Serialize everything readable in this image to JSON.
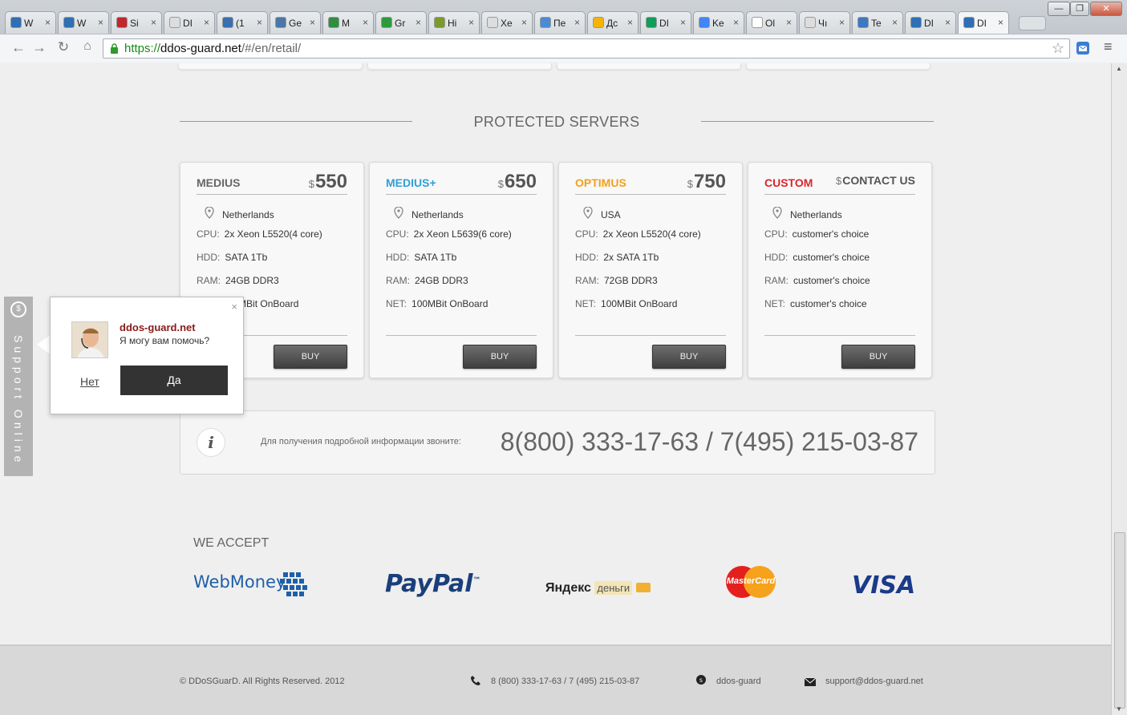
{
  "browser": {
    "tabs": [
      {
        "label": "W",
        "color": "#2f6fb4"
      },
      {
        "label": "W",
        "color": "#2f6fb4"
      },
      {
        "label": "Si",
        "color": "#c0282d"
      },
      {
        "label": "DI",
        "color": "#dddddd"
      },
      {
        "label": "(1",
        "color": "#3a6fb0"
      },
      {
        "label": "Ge",
        "color": "#4a76a8"
      },
      {
        "label": "M",
        "color": "#2f8f3f"
      },
      {
        "label": "Gr",
        "color": "#2e9b3a"
      },
      {
        "label": "Hi",
        "color": "#7a9a2a"
      },
      {
        "label": "Xe",
        "color": "#dddddd"
      },
      {
        "label": "Пе",
        "color": "#4a8bd6"
      },
      {
        "label": "Дс",
        "color": "#f4b400"
      },
      {
        "label": "DI",
        "color": "#0f9d58"
      },
      {
        "label": "Ke",
        "color": "#4285f4"
      },
      {
        "label": "Ol",
        "color": "#ffffff"
      },
      {
        "label": "Чı",
        "color": "#dddddd"
      },
      {
        "label": "Te",
        "color": "#3c78c3"
      },
      {
        "label": "DI",
        "color": "#2f6fb4"
      },
      {
        "label": "DI",
        "color": "#2f6fb4"
      }
    ],
    "url_scheme": "https://",
    "url_host": "ddos-guard.net",
    "url_path": "/#/en/retail/",
    "tab_close": "×",
    "win_min": "—",
    "win_max": "❐",
    "win_close": "✕"
  },
  "section": {
    "title": "PROTECTED SERVERS"
  },
  "servers": [
    {
      "name": "MEDIUS",
      "name_color": "#666666",
      "currency": "$",
      "price": "550",
      "location": "Netherlands",
      "cpu_label": "CPU:",
      "cpu": "2x Xeon L5520(4 core)",
      "hdd_label": "HDD:",
      "hdd": "SATA 1Tb",
      "ram_label": "RAM:",
      "ram": "24GB DDR3",
      "net_label": "NET:",
      "net": "100MBit OnBoard",
      "buy": "BUY"
    },
    {
      "name": "MEDIUS+",
      "name_color": "#2f9fd8",
      "currency": "$",
      "price": "650",
      "location": "Netherlands",
      "cpu_label": "CPU:",
      "cpu": "2x Xeon L5639(6 core)",
      "hdd_label": "HDD:",
      "hdd": "SATA 1Tb",
      "ram_label": "RAM:",
      "ram": "24GB DDR3",
      "net_label": "NET:",
      "net": "100MBit OnBoard",
      "buy": "BUY"
    },
    {
      "name": "OPTIMUS",
      "name_color": "#f0a020",
      "currency": "$",
      "price": "750",
      "location": "USA",
      "cpu_label": "CPU:",
      "cpu": "2x Xeon L5520(4 core)",
      "hdd_label": "HDD:",
      "hdd": "2x SATA 1Tb",
      "ram_label": "RAM:",
      "ram": "72GB DDR3",
      "net_label": "NET:",
      "net": "100MBit OnBoard",
      "buy": "BUY"
    },
    {
      "name": "CUSTOM",
      "name_color": "#d9262c",
      "currency": "$",
      "price": "CONTACT US",
      "location": "Netherlands",
      "cpu_label": "CPU:",
      "cpu": "customer's choice",
      "hdd_label": "HDD:",
      "hdd": "customer's choice",
      "ram_label": "RAM:",
      "ram": "customer's choice",
      "net_label": "NET:",
      "net": "customer's choice",
      "buy": "BUY"
    }
  ],
  "info": {
    "icon": "i",
    "text": "Для получения подробной информации звоните:",
    "phone": "8(800) 333-17-63 / 7(495) 215-03-87"
  },
  "accept": {
    "title": "WE ACCEPT",
    "webmoney": "WebMoney",
    "paypal": "PayPal",
    "paypal_tm": "™",
    "yandex": "Яндекс",
    "yandex_money": "деньги",
    "mastercard": "MasterCard",
    "visa": "VISA"
  },
  "footer": {
    "copyright": "© DDoSGuarD. All Rights Reserved. 2012",
    "phone": "8 (800) 333-17-63 / 7 (495) 215-03-87",
    "skype": "ddos-guard",
    "email": "support@ddos-guard.net"
  },
  "support": {
    "tab_label": "Support Online",
    "icon": "$"
  },
  "popup": {
    "close": "×",
    "site": "ddos-guard.net",
    "message": "Я могу вам помочь?",
    "no": "Нет",
    "yes": "Да"
  }
}
